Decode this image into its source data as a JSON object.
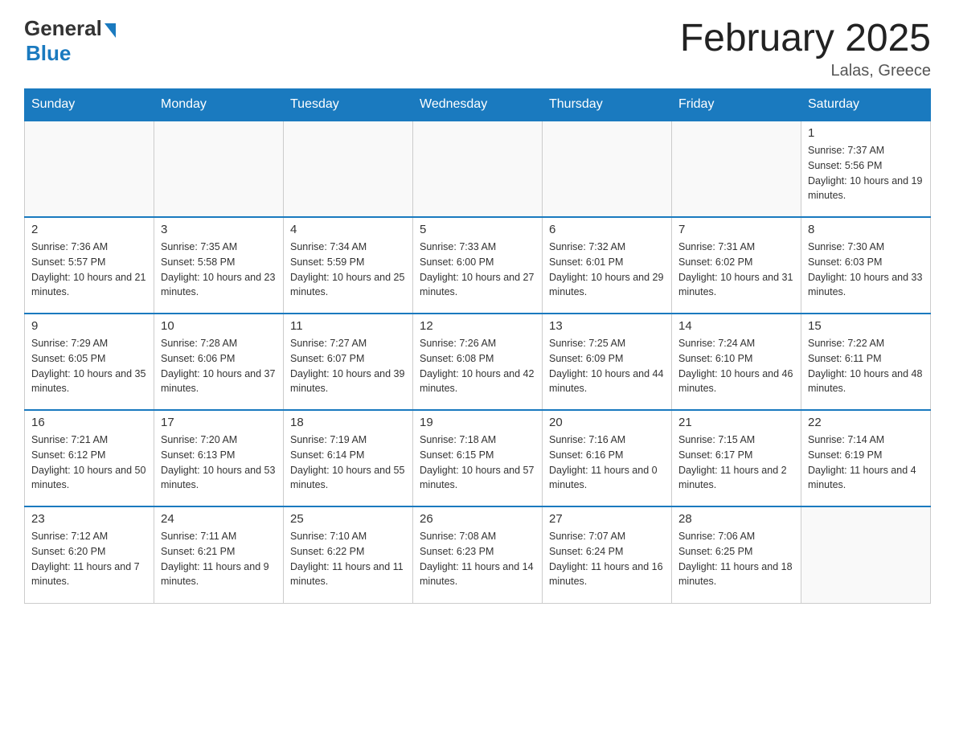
{
  "header": {
    "logo_general": "General",
    "logo_blue": "Blue",
    "title": "February 2025",
    "location": "Lalas, Greece"
  },
  "weekdays": [
    "Sunday",
    "Monday",
    "Tuesday",
    "Wednesday",
    "Thursday",
    "Friday",
    "Saturday"
  ],
  "weeks": [
    [
      {
        "day": "",
        "info": ""
      },
      {
        "day": "",
        "info": ""
      },
      {
        "day": "",
        "info": ""
      },
      {
        "day": "",
        "info": ""
      },
      {
        "day": "",
        "info": ""
      },
      {
        "day": "",
        "info": ""
      },
      {
        "day": "1",
        "info": "Sunrise: 7:37 AM\nSunset: 5:56 PM\nDaylight: 10 hours and 19 minutes."
      }
    ],
    [
      {
        "day": "2",
        "info": "Sunrise: 7:36 AM\nSunset: 5:57 PM\nDaylight: 10 hours and 21 minutes."
      },
      {
        "day": "3",
        "info": "Sunrise: 7:35 AM\nSunset: 5:58 PM\nDaylight: 10 hours and 23 minutes."
      },
      {
        "day": "4",
        "info": "Sunrise: 7:34 AM\nSunset: 5:59 PM\nDaylight: 10 hours and 25 minutes."
      },
      {
        "day": "5",
        "info": "Sunrise: 7:33 AM\nSunset: 6:00 PM\nDaylight: 10 hours and 27 minutes."
      },
      {
        "day": "6",
        "info": "Sunrise: 7:32 AM\nSunset: 6:01 PM\nDaylight: 10 hours and 29 minutes."
      },
      {
        "day": "7",
        "info": "Sunrise: 7:31 AM\nSunset: 6:02 PM\nDaylight: 10 hours and 31 minutes."
      },
      {
        "day": "8",
        "info": "Sunrise: 7:30 AM\nSunset: 6:03 PM\nDaylight: 10 hours and 33 minutes."
      }
    ],
    [
      {
        "day": "9",
        "info": "Sunrise: 7:29 AM\nSunset: 6:05 PM\nDaylight: 10 hours and 35 minutes."
      },
      {
        "day": "10",
        "info": "Sunrise: 7:28 AM\nSunset: 6:06 PM\nDaylight: 10 hours and 37 minutes."
      },
      {
        "day": "11",
        "info": "Sunrise: 7:27 AM\nSunset: 6:07 PM\nDaylight: 10 hours and 39 minutes."
      },
      {
        "day": "12",
        "info": "Sunrise: 7:26 AM\nSunset: 6:08 PM\nDaylight: 10 hours and 42 minutes."
      },
      {
        "day": "13",
        "info": "Sunrise: 7:25 AM\nSunset: 6:09 PM\nDaylight: 10 hours and 44 minutes."
      },
      {
        "day": "14",
        "info": "Sunrise: 7:24 AM\nSunset: 6:10 PM\nDaylight: 10 hours and 46 minutes."
      },
      {
        "day": "15",
        "info": "Sunrise: 7:22 AM\nSunset: 6:11 PM\nDaylight: 10 hours and 48 minutes."
      }
    ],
    [
      {
        "day": "16",
        "info": "Sunrise: 7:21 AM\nSunset: 6:12 PM\nDaylight: 10 hours and 50 minutes."
      },
      {
        "day": "17",
        "info": "Sunrise: 7:20 AM\nSunset: 6:13 PM\nDaylight: 10 hours and 53 minutes."
      },
      {
        "day": "18",
        "info": "Sunrise: 7:19 AM\nSunset: 6:14 PM\nDaylight: 10 hours and 55 minutes."
      },
      {
        "day": "19",
        "info": "Sunrise: 7:18 AM\nSunset: 6:15 PM\nDaylight: 10 hours and 57 minutes."
      },
      {
        "day": "20",
        "info": "Sunrise: 7:16 AM\nSunset: 6:16 PM\nDaylight: 11 hours and 0 minutes."
      },
      {
        "day": "21",
        "info": "Sunrise: 7:15 AM\nSunset: 6:17 PM\nDaylight: 11 hours and 2 minutes."
      },
      {
        "day": "22",
        "info": "Sunrise: 7:14 AM\nSunset: 6:19 PM\nDaylight: 11 hours and 4 minutes."
      }
    ],
    [
      {
        "day": "23",
        "info": "Sunrise: 7:12 AM\nSunset: 6:20 PM\nDaylight: 11 hours and 7 minutes."
      },
      {
        "day": "24",
        "info": "Sunrise: 7:11 AM\nSunset: 6:21 PM\nDaylight: 11 hours and 9 minutes."
      },
      {
        "day": "25",
        "info": "Sunrise: 7:10 AM\nSunset: 6:22 PM\nDaylight: 11 hours and 11 minutes."
      },
      {
        "day": "26",
        "info": "Sunrise: 7:08 AM\nSunset: 6:23 PM\nDaylight: 11 hours and 14 minutes."
      },
      {
        "day": "27",
        "info": "Sunrise: 7:07 AM\nSunset: 6:24 PM\nDaylight: 11 hours and 16 minutes."
      },
      {
        "day": "28",
        "info": "Sunrise: 7:06 AM\nSunset: 6:25 PM\nDaylight: 11 hours and 18 minutes."
      },
      {
        "day": "",
        "info": ""
      }
    ]
  ]
}
